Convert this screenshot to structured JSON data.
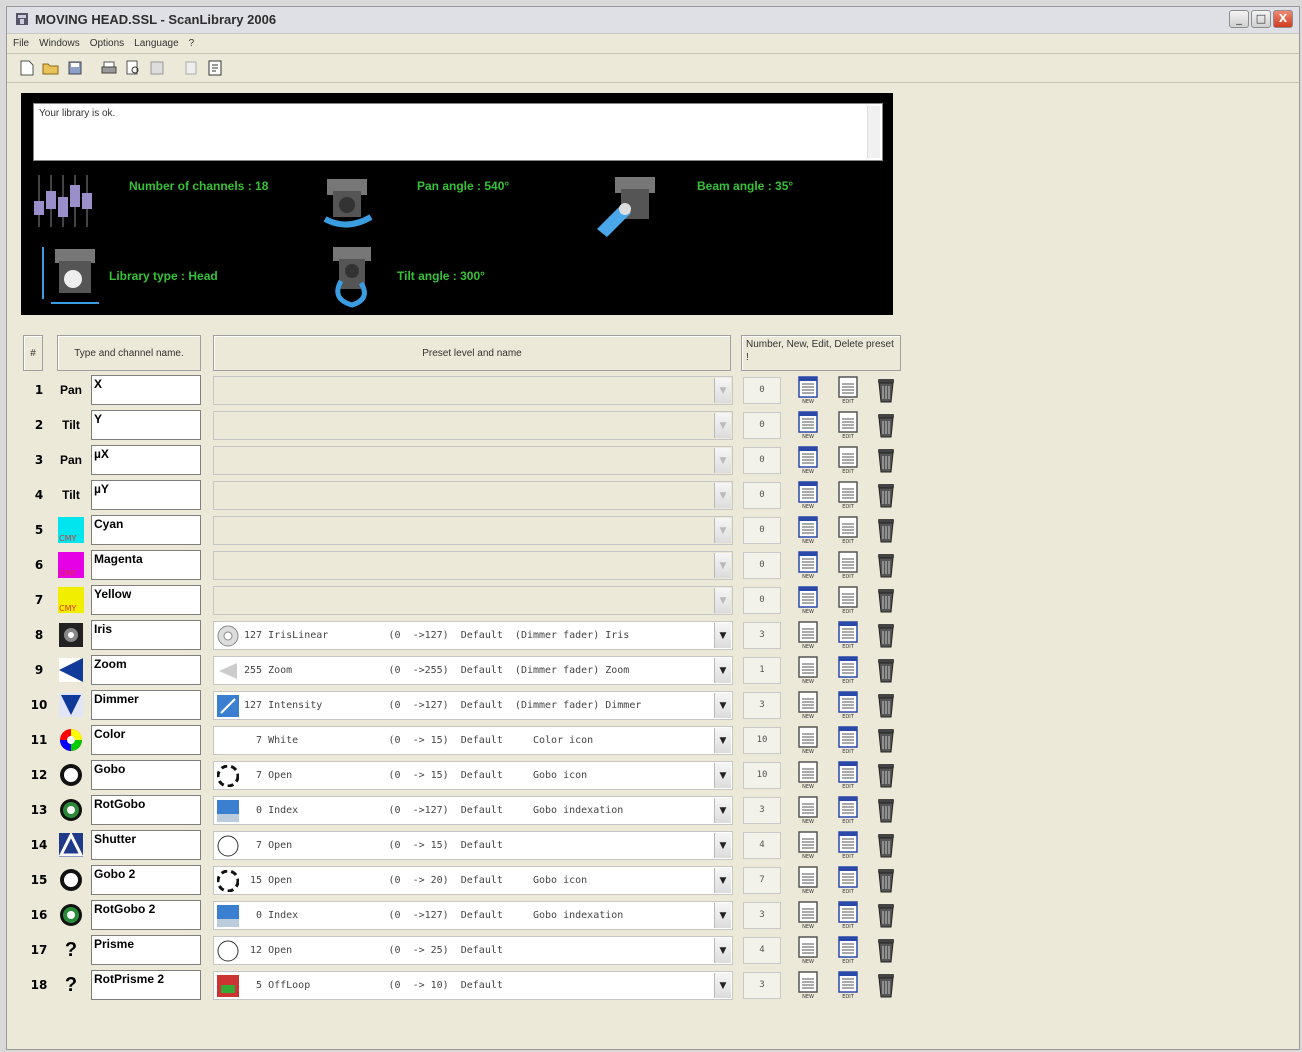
{
  "window": {
    "title": "MOVING HEAD.SSL - ScanLibrary 2006",
    "buttons": [
      "_",
      "□",
      "X"
    ]
  },
  "menu": [
    "File",
    "Windows",
    "Options",
    "Language",
    "?"
  ],
  "toolbar": {
    "icons": [
      "new-icon",
      "open-icon",
      "save-icon",
      "print-icon",
      "print-preview-icon",
      "export-icon",
      "import-icon",
      "document-icon"
    ]
  },
  "info": {
    "message": "Your library is ok.",
    "channels": "Number of channels : 18",
    "pan": "Pan angle : 540°",
    "beam": "Beam angle : 35°",
    "type": "Library type : Head",
    "tilt": "Tilt angle : 300°"
  },
  "grid": {
    "headers": {
      "num": "#",
      "type": "Type and channel name.",
      "preset": "Preset level and name",
      "actions": "Number, New, Edit, Delete preset !"
    },
    "action_labels": {
      "new": "NEW",
      "edit": "EDIT"
    },
    "rows": [
      {
        "n": "1",
        "type": "Pan",
        "name": "X",
        "preset": "",
        "count": "0",
        "icon": "pan-text",
        "edit_on": false
      },
      {
        "n": "2",
        "type": "Tilt",
        "name": "Y",
        "preset": "",
        "count": "0",
        "icon": "tilt-text",
        "edit_on": false
      },
      {
        "n": "3",
        "type": "Pan",
        "name": "µX",
        "preset": "",
        "count": "0",
        "icon": "pan-fine-text",
        "edit_on": false
      },
      {
        "n": "4",
        "type": "Tilt",
        "name": "µY",
        "preset": "",
        "count": "0",
        "icon": "tilt-fine-text",
        "edit_on": false
      },
      {
        "n": "5",
        "type": "CMY",
        "name": "Cyan",
        "preset": "",
        "count": "0",
        "icon": "cyan",
        "edit_on": false
      },
      {
        "n": "6",
        "type": "CMY",
        "name": "Magenta",
        "preset": "",
        "count": "0",
        "icon": "magenta",
        "edit_on": false
      },
      {
        "n": "7",
        "type": "CMY",
        "name": "Yellow",
        "preset": "",
        "count": "0",
        "icon": "yellow",
        "edit_on": false
      },
      {
        "n": "8",
        "type": "",
        "name": "Iris",
        "preset": "127 IrisLinear          (0  ->127)  Default  (Dimmer fader) Iris",
        "count": "3",
        "icon": "iris",
        "edit_on": true
      },
      {
        "n": "9",
        "type": "",
        "name": "Zoom",
        "preset": "255 Zoom                (0  ->255)  Default  (Dimmer fader) Zoom",
        "count": "1",
        "icon": "zoom",
        "edit_on": true
      },
      {
        "n": "10",
        "type": "",
        "name": "Dimmer",
        "preset": "127 Intensity           (0  ->127)  Default  (Dimmer fader) Dimmer",
        "count": "3",
        "icon": "dimmer",
        "edit_on": true
      },
      {
        "n": "11",
        "type": "",
        "name": "Color",
        "preset": "  7 White               (0  -> 15)  Default     Color icon",
        "count": "10",
        "icon": "color",
        "edit_on": true
      },
      {
        "n": "12",
        "type": "",
        "name": "Gobo",
        "preset": "  7 Open                (0  -> 15)  Default     Gobo icon",
        "count": "10",
        "icon": "gobo",
        "edit_on": true
      },
      {
        "n": "13",
        "type": "",
        "name": "RotGobo",
        "preset": "  0 Index               (0  ->127)  Default     Gobo indexation",
        "count": "3",
        "icon": "rotgobo",
        "edit_on": true
      },
      {
        "n": "14",
        "type": "",
        "name": "Shutter",
        "preset": "  7 Open                (0  -> 15)  Default",
        "count": "4",
        "icon": "shutter",
        "edit_on": true
      },
      {
        "n": "15",
        "type": "",
        "name": "Gobo 2",
        "preset": " 15 Open                (0  -> 20)  Default     Gobo icon",
        "count": "7",
        "icon": "gobo",
        "edit_on": true
      },
      {
        "n": "16",
        "type": "",
        "name": "RotGobo 2",
        "preset": "  0 Index               (0  ->127)  Default     Gobo indexation",
        "count": "3",
        "icon": "rotgobo",
        "edit_on": true
      },
      {
        "n": "17",
        "type": "?",
        "name": "Prisme",
        "preset": " 12 Open                (0  -> 25)  Default",
        "count": "4",
        "icon": "question",
        "edit_on": true
      },
      {
        "n": "18",
        "type": "?",
        "name": "RotPrisme 2",
        "preset": "  5 OffLoop             (0  -> 10)  Default",
        "count": "3",
        "icon": "question",
        "edit_on": true
      }
    ]
  },
  "colors": {
    "info_text": "#36c236",
    "cyan": "#00e5ee",
    "magenta": "#e600e6",
    "yellow": "#f2ee00"
  }
}
